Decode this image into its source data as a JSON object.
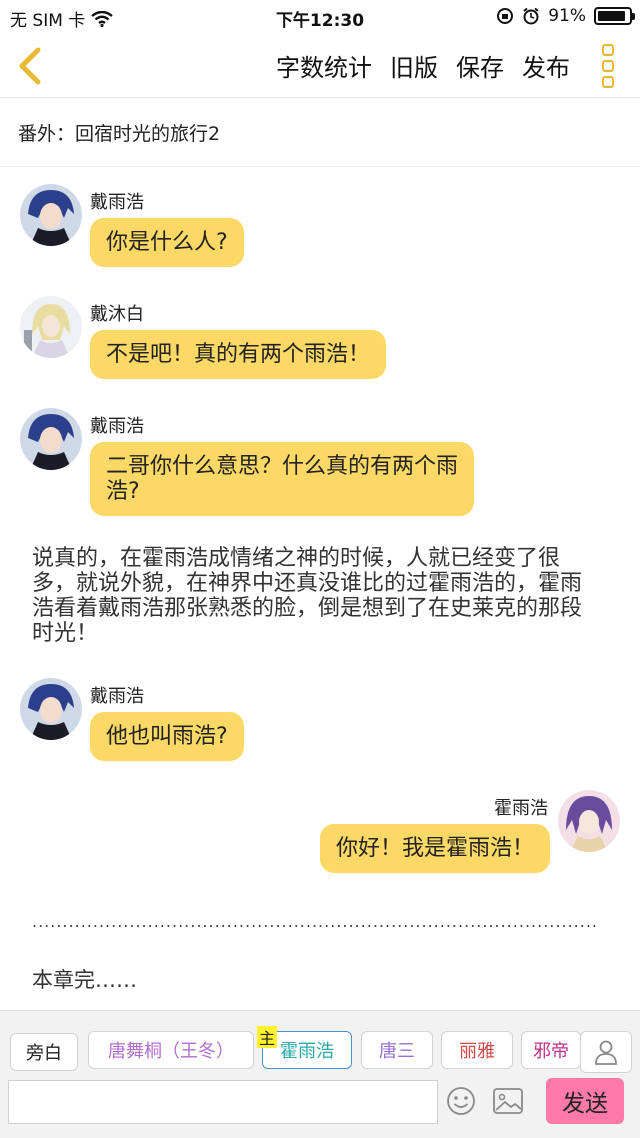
{
  "status_bar": {
    "carrier": "无 SIM 卡",
    "time": "下午12:30",
    "battery_percent": "91%",
    "battery_level": 0.91,
    "icons": [
      "wifi-icon",
      "orientation-lock-icon",
      "alarm-icon",
      "battery-icon"
    ]
  },
  "nav": {
    "back_icon": "chevron-left-icon",
    "actions": [
      "字数统计",
      "旧版",
      "保存",
      "发布"
    ],
    "more_icon": "more-vertical-icon",
    "accent_color": "#e9b933"
  },
  "chapter": {
    "title": "番外：回宿时光的旅行2"
  },
  "messages": [
    {
      "sender": "戴雨浩",
      "text": "你是什么人?",
      "side": "left",
      "avatar": "avatar-blue-hair"
    },
    {
      "sender": "戴沐白",
      "text": "不是吧！真的有两个雨浩！",
      "side": "left",
      "avatar": "avatar-blond-hair"
    },
    {
      "sender": "戴雨浩",
      "text": "二哥你什么意思？什么真的有两个雨浩?",
      "side": "left",
      "avatar": "avatar-blue-hair"
    },
    {
      "narration": "说真的，在霍雨浩成情绪之神的时候，人就已经变了很多，就说外貌，在神界中还真没谁比的过霍雨浩的，霍雨浩看着戴雨浩那张熟悉的脸，倒是想到了在史莱克的那段时光！"
    },
    {
      "sender": "戴雨浩",
      "text": "他也叫雨浩?",
      "side": "left",
      "avatar": "avatar-blue-hair"
    },
    {
      "sender": "霍雨浩",
      "text": "你好！我是霍雨浩！",
      "side": "right",
      "avatar": "avatar-purple-hair"
    }
  ],
  "bubble_color": "#fcd966",
  "chapter_end": {
    "dots": "...............................................................................................................................................................",
    "text": "本章完……"
  },
  "characters": {
    "chips": [
      {
        "label": "旁白",
        "color": "#222222"
      },
      {
        "label": "唐舞桐（王冬）",
        "color": "#b070d0"
      },
      {
        "label": "霍雨浩",
        "color": "#2aa8a8",
        "selected": true,
        "main_tag": "主"
      },
      {
        "label": "唐三",
        "color": "#9a6fd0"
      },
      {
        "label": "丽雅",
        "color": "#d04848"
      },
      {
        "label": "邪帝",
        "color": "#c0308a"
      }
    ],
    "person_icon": "person-icon"
  },
  "input": {
    "placeholder": "",
    "emoji_icon": "smiley-icon",
    "image_icon": "image-icon",
    "send_label": "发送",
    "send_color": "#ff7aa8"
  }
}
